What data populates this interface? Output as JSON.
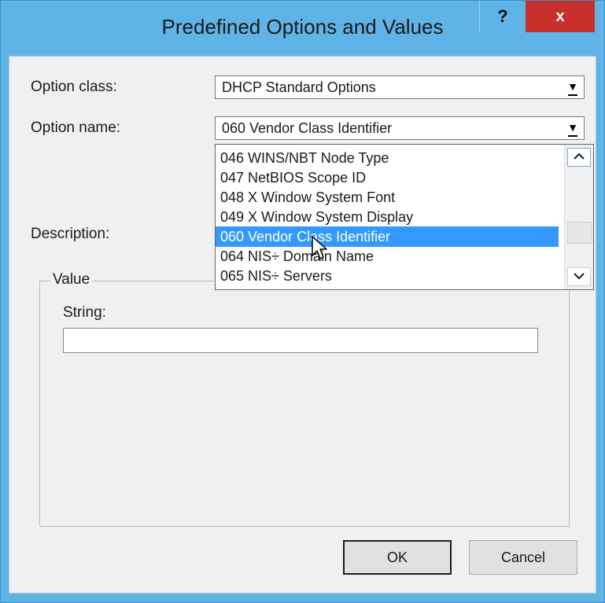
{
  "window": {
    "title": "Predefined Options and Values",
    "help_label": "?",
    "close_label": "x"
  },
  "form": {
    "option_class_label": "Option class:",
    "option_class_value": "DHCP Standard Options",
    "option_name_label": "Option name:",
    "option_name_value": "060 Vendor Class Identifier",
    "description_label": "Description:"
  },
  "dropdown": {
    "items": [
      "046 WINS/NBT Node Type",
      "047 NetBIOS Scope ID",
      "048 X Window System Font",
      "049 X Window System Display",
      "060 Vendor Class Identifier",
      "064 NIS÷ Domain Name",
      "065 NIS÷ Servers"
    ],
    "selected_index": 4,
    "scroll_up_glyph": "^",
    "scroll_down_glyph": "v"
  },
  "value_group": {
    "legend": "Value",
    "string_label": "String:",
    "string_value": ""
  },
  "buttons": {
    "ok_label": "OK",
    "cancel_label": "Cancel"
  },
  "colors": {
    "title_bar": "#5fb3e6",
    "close_button": "#c9302c",
    "selection": "#3399ff"
  }
}
